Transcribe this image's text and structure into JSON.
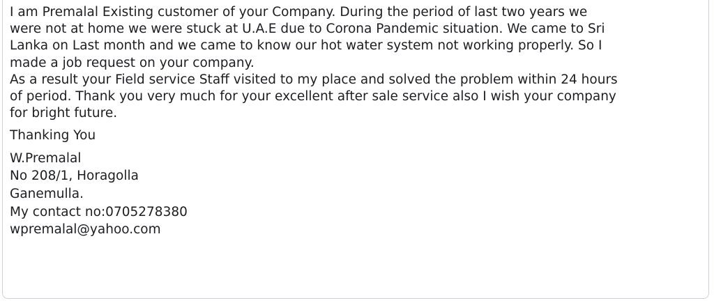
{
  "message": {
    "paragraph_1": [
      "I am Premalal Existing customer of your Company. During the period of last two years we",
      "were not at home we were stuck at U.A.E due to Corona Pandemic situation. We came to Sri",
      "Lanka on Last month and we came to know our hot water system not working properly. So I",
      "made a job request on your company."
    ],
    "paragraph_2": [
      "As a result your Field service Staff visited to my place and solved the problem within 24 hours",
      "of period. Thank you very much for your excellent after sale service also I wish your company",
      "for bright future."
    ],
    "closing": "Thanking You",
    "signature": {
      "name": "W.Premalal",
      "address_line_1": "No 208/1, Horagolla",
      "address_line_2": "Ganemulla.",
      "contact": "My contact no:0705278380",
      "email": "wpremalal@yahoo.com"
    }
  }
}
